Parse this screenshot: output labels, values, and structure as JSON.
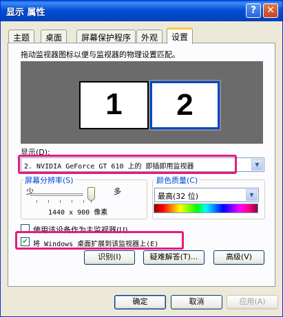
{
  "window": {
    "title": "显示 属性",
    "help_button": "?",
    "close_button": "✕"
  },
  "tabs": [
    {
      "label": "主题",
      "active": false
    },
    {
      "label": "桌面",
      "active": false
    },
    {
      "label": "屏幕保护程序",
      "active": false
    },
    {
      "label": "外观",
      "active": false
    },
    {
      "label": "设置",
      "active": true
    }
  ],
  "settings": {
    "instruction": "拖动监视器图标以便与监视器的物理设置匹配。",
    "monitors": [
      {
        "number": "1",
        "selected": false
      },
      {
        "number": "2",
        "selected": true
      }
    ],
    "display_label": "显示(D):",
    "display_value": "2. NVIDIA GeForce GT 610 上的 即插即用监视器",
    "resolution": {
      "title": "屏幕分辨率(S)",
      "less": "少",
      "more": "多",
      "value": "1440 x 900 像素"
    },
    "color_quality": {
      "title": "颜色质量(C)",
      "value": "最高(32 位)"
    },
    "primary_checkbox": {
      "label": "使用该设备作为主监视器(U)",
      "checked": false
    },
    "extend_checkbox": {
      "label": "将 Windows 桌面扩展到该监视器上(E)",
      "checked": true
    },
    "identify_button": "识别(I)",
    "troubleshoot_button": "疑难解答(T)...",
    "advanced_button": "高级(V)"
  },
  "footer": {
    "ok_button": "确定",
    "cancel_button": "取消",
    "apply_button": "应用(A)"
  },
  "colors": {
    "titlebar": "#0046c8",
    "highlight": "#e6197f",
    "group_title": "#0046d5",
    "tab_accent": "#ffc83c"
  }
}
